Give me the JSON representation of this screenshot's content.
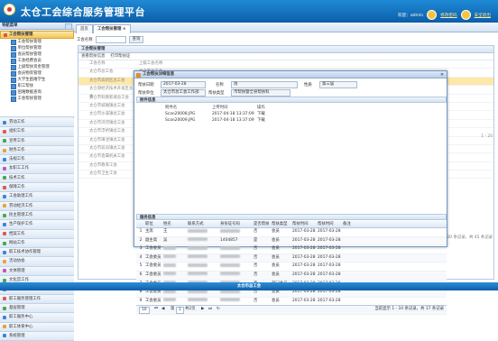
{
  "header": {
    "title": "太仓工会综合服务管理平台",
    "welcome": "欢迎：admin",
    "modify_password": "修改密码",
    "logout": "安全退出"
  },
  "sidebar": {
    "title": "导航菜单",
    "active_group": "工会帮扶管理",
    "sub_items": [
      "工会帮扶管理",
      "单位帮扶管理",
      "会员帮扶管理",
      "工会经费会员",
      "上级帮扶资金管理",
      "会员物资管理",
      "大学生困难学生",
      "职工帮扶",
      "困难数据查询",
      "工会帮扶管理"
    ],
    "groups": [
      {
        "label": "劳动工作",
        "color": "#3d86d4"
      },
      {
        "label": "组织工作",
        "color": "#e05a4f"
      },
      {
        "label": "宣传工作",
        "color": "#49a94f"
      },
      {
        "label": "财务工作",
        "color": "#e9a23b"
      },
      {
        "label": "法规工作",
        "color": "#3d86d4"
      },
      {
        "label": "女职工工作",
        "color": "#c356b8"
      },
      {
        "label": "技术工作",
        "color": "#49a94f"
      },
      {
        "label": "保障工作",
        "color": "#e05a4f"
      },
      {
        "label": "工会助理工作",
        "color": "#3d86d4"
      },
      {
        "label": "劳动经济工作",
        "color": "#e9a23b"
      },
      {
        "label": "民主管理工作",
        "color": "#49a94f"
      },
      {
        "label": "生产保护工作",
        "color": "#3d86d4"
      },
      {
        "label": "档案工作",
        "color": "#e05a4f"
      },
      {
        "label": "网站工作",
        "color": "#49a94f"
      },
      {
        "label": "职工技术协作管理",
        "color": "#3d86d4"
      },
      {
        "label": "活动协会",
        "color": "#e9a23b"
      },
      {
        "label": "文体管理",
        "color": "#c356b8"
      },
      {
        "label": "文化宫工作",
        "color": "#49a94f"
      },
      {
        "label": "会员服务",
        "color": "#3d86d4"
      },
      {
        "label": "职工服务管理工作",
        "color": "#e05a4f"
      },
      {
        "label": "基层管理",
        "color": "#49a94f"
      },
      {
        "label": "职工服务中心",
        "color": "#3d86d4"
      },
      {
        "label": "职工体育中心",
        "color": "#e9a23b"
      },
      {
        "label": "系统管理",
        "color": "#3d86d4"
      }
    ]
  },
  "tabs": [
    {
      "label": "首页"
    },
    {
      "label": "工会帮扶管理 ×"
    }
  ],
  "main": {
    "search_label": "工会名称",
    "search_button": "查询",
    "list_title": "工会帮扶管理",
    "toolbar": [
      "查看帮扶信息",
      "打印帮扶证"
    ],
    "bg_rows": [
      {
        "a": "工会名称",
        "b": "上级工会名称"
      },
      {
        "a": "太仓市总工会",
        "b": "太仓市总工会"
      },
      {
        "a": "太仓市高新区总工会",
        "b": "太仓市总工会"
      },
      {
        "a": "太仓港经济技术开发区总工会",
        "b": "太仓市总工会"
      },
      {
        "a": "太仓市科教新城总工会",
        "b": "太仓市总工会"
      },
      {
        "a": "太仓市城厢镇总工会",
        "b": "太仓市总工会"
      },
      {
        "a": "太仓市沙溪镇总工会",
        "b": "太仓市总工会"
      },
      {
        "a": "太仓市浏河镇总工会",
        "b": "太仓市总工会"
      },
      {
        "a": "太仓市浮桥镇总工会",
        "b": "太仓市总工会"
      },
      {
        "a": "太仓市璜泾镇总工会",
        "b": "太仓市总工会"
      },
      {
        "a": "太仓市双凤镇总工会",
        "b": "太仓市总工会"
      },
      {
        "a": "太仓市直属机关工会",
        "b": "太仓市总工会"
      },
      {
        "a": "太仓市教育工会",
        "b": "太仓市总工会"
      },
      {
        "a": "太仓市卫生工会",
        "b": "太仓市总工会"
      }
    ],
    "pager_right": "1 - 20",
    "record_info": "显示 1 - 20 条记录，共 45 条记录"
  },
  "modal": {
    "title": "工会帮扶详细信息",
    "fields": [
      {
        "label": "帮扶日期",
        "value": "2017-03-28"
      },
      {
        "label": "名称",
        "value": "坊"
      },
      {
        "label": "性质",
        "value": "第三届"
      }
    ],
    "fields2": [
      {
        "label": "帮扶单位",
        "value": "太仓市总工会工作部"
      },
      {
        "label": "帮扶类型",
        "value": "市帮扶暨全县帮扶科"
      }
    ],
    "attachments_title": "附件信息",
    "attach_headers": [
      "附件名",
      "上传时间",
      "操作"
    ],
    "attachments": [
      {
        "name": "Scan20008.JPG",
        "time": "2017-04-18 13:37:09",
        "op": "下载"
      },
      {
        "name": "Scan20009.JPG",
        "time": "2017-04-18 13:37:09",
        "op": "下载"
      }
    ],
    "members_title": "服务信息",
    "grid_headers": [
      "",
      "职位",
      "姓名",
      "联系方式",
      "身份证号码",
      "是否帮扶",
      "帮扶类型",
      "帮扶时间",
      "帮扶时间",
      "备注"
    ],
    "grid_rows": [
      {
        "n": "1",
        "role": "主席",
        "name": "王",
        "phone": "",
        "id": "",
        "flag": "否",
        "type": "会员",
        "t1": "2017-03-28",
        "t2": "2017-03-28",
        "note": ""
      },
      {
        "n": "2",
        "role": "副主席",
        "name": "吴",
        "phone": "",
        "id": "1404857",
        "flag": "是",
        "type": "会员",
        "t1": "2017-03-28",
        "t2": "2017-03-28",
        "note": ""
      },
      {
        "n": "3",
        "role": "工会委员",
        "name": "",
        "phone": "",
        "id": "",
        "flag": "否",
        "type": "会员",
        "t1": "2017-03-28",
        "t2": "2017-03-28",
        "note": ""
      },
      {
        "n": "4",
        "role": "工会委员",
        "name": "",
        "phone": "",
        "id": "",
        "flag": "否",
        "type": "会员",
        "t1": "2017-03-28",
        "t2": "2017-03-28",
        "note": ""
      },
      {
        "n": "5",
        "role": "工会委员",
        "name": "",
        "phone": "",
        "id": "",
        "flag": "否",
        "type": "会员",
        "t1": "2017-03-28",
        "t2": "2017-03-28",
        "note": ""
      },
      {
        "n": "6",
        "role": "工会委员",
        "name": "",
        "phone": "",
        "id": "",
        "flag": "否",
        "type": "会员",
        "t1": "2017-03-28",
        "t2": "2017-03-28",
        "note": ""
      },
      {
        "n": "7",
        "role": "工会委员",
        "name": "",
        "phone": "",
        "id": "",
        "flag": "否",
        "type": "部门会员",
        "t1": "2017-03-28",
        "t2": "2017-03-28",
        "note": ""
      },
      {
        "n": "8",
        "role": "工会委员",
        "name": "",
        "phone": "",
        "id": "",
        "flag": "否",
        "type": "会员",
        "t1": "2017-03-28",
        "t2": "2017-03-28",
        "note": ""
      },
      {
        "n": "9",
        "role": "工会委员",
        "name": "",
        "phone": "",
        "id": "",
        "flag": "否",
        "type": "会员",
        "t1": "2017-03-28",
        "t2": "2017-03-28",
        "note": ""
      },
      {
        "n": "10",
        "role": "工会委员",
        "name": "",
        "phone": "",
        "id": "",
        "flag": "否",
        "type": "会员",
        "t1": "2017-03-28",
        "t2": "2017-03-28",
        "note": ""
      }
    ],
    "pager": {
      "page_size": "10",
      "page_label": "第",
      "page": "1",
      "of": "共2页",
      "info": "当前显示 1 - 10 条记录，共 17 条记录"
    }
  },
  "footer": {
    "text": "太仓市总工会"
  }
}
